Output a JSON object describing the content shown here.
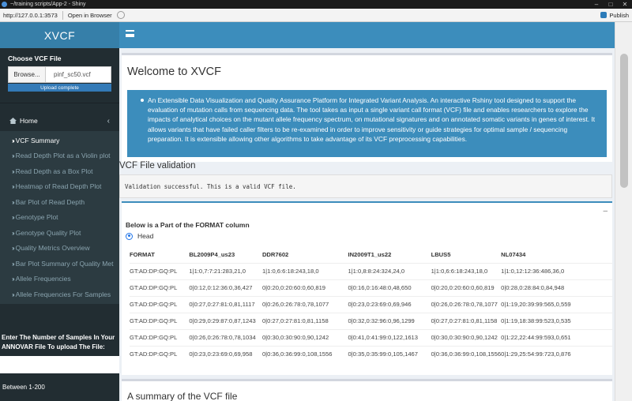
{
  "window": {
    "title": "~/training scripts/App-2 - Shiny"
  },
  "viewer": {
    "url": "http://127.0.0.1:3573",
    "open_browser": "Open in Browser",
    "publish": "Publish"
  },
  "sidebar": {
    "logo": "XVCF",
    "upload": {
      "label": "Choose VCF File",
      "browse": "Browse...",
      "filename": "pinf_sc50.vcf",
      "status": "Upload complete"
    },
    "home": "Home",
    "items": [
      {
        "label": "VCF Summary"
      },
      {
        "label": "Read Depth Plot as a Violin plot"
      },
      {
        "label": "Read Depth as a Box Plot"
      },
      {
        "label": "Heatmap of Read Depth Plot"
      },
      {
        "label": "Bar Plot of Read Depth"
      },
      {
        "label": "Genotype Plot"
      },
      {
        "label": "Genotype Quality Plot"
      },
      {
        "label": "Quality Metrics Overview"
      },
      {
        "label": "Bar Plot Summary of Quality Met"
      },
      {
        "label": "Allele Frequencies"
      },
      {
        "label": "Allele Frequencies For Samples"
      }
    ],
    "samples": {
      "question_1": "Enter The Number of Samples In Your",
      "question_2": "ANNOVAR File To upload The File:",
      "hint": "Between 1-200"
    }
  },
  "main": {
    "welcome_title": "Welcome to XVCF",
    "description": "An Extensible Data Visualization and Quality Assurance Platform for Integrated Variant Analysis. An interactive Rshiny tool designed to support the evaluation of mutation calls from sequencing data. The tool takes as input a single variant call format (VCF) file and enables researchers to explore the impacts of analytical choices on the mutant allele frequency spectrum, on mutational signatures and on annotated somatic variants in genes of interest. It allows variants that have failed caller filters to be re-examined in order to improve sensitivity or guide strategies for optimal sample / sequencing preparation. It is extensible allowing other algorithms to take advantage of its VCF preprocessing capabilities.",
    "validation_title": "VCF File validation",
    "validation_msg": "Validation successful. This is a valid VCF file.",
    "format_title": "Below is a Part of the FORMAT column",
    "radio_head": "Head",
    "table": {
      "headers": [
        "FORMAT",
        "BL2009P4_us23",
        "DDR7602",
        "IN2009T1_us22",
        "LBUS5",
        "NL07434"
      ],
      "rows": [
        [
          "GT:AD:DP:GQ:PL",
          "1|1:0,7:7:21:283,21,0",
          "1|1:0,6:6:18:243,18,0",
          "1|1:0,8:8:24:324,24,0",
          "1|1:0,6:6:18:243,18,0",
          "1|1:0,12:12:36:486,36,0"
        ],
        [
          "GT:AD:DP:GQ:PL",
          "0|0:12,0:12:36:0,36,427",
          "0|0:20,0:20:60:0,60,819",
          "0|0:16,0:16:48:0,48,650",
          "0|0:20,0:20:60:0,60,819",
          "0|0:28,0:28:84:0,84,948"
        ],
        [
          "GT:AD:DP:GQ:PL",
          "0|0:27,0:27:81:0,81,1117",
          "0|0:26,0:26:78:0,78,1077",
          "0|0:23,0:23:69:0,69,946",
          "0|0:26,0:26:78:0,78,1077",
          "0|1:19,20:39:99:565,0,559"
        ],
        [
          "GT:AD:DP:GQ:PL",
          "0|0:29,0:29:87:0,87,1243",
          "0|0:27,0:27:81:0,81,1158",
          "0|0:32,0:32:96:0,96,1299",
          "0|0:27,0:27:81:0,81,1158",
          "0|1:19,18:38:99:523,0,535"
        ],
        [
          "GT:AD:DP:GQ:PL",
          "0|0:26,0:26:78:0,78,1034",
          "0|0:30,0:30:90:0,90,1242",
          "0|0:41,0:41:99:0,122,1613",
          "0|0:30,0:30:90:0,90,1242",
          "0|1:22,22:44:99:593,0,651"
        ],
        [
          "GT:AD:DP:GQ:PL",
          "0|0:23,0:23:69:0,69,958",
          "0|0:36,0:36:99:0,108,1556",
          "0|0:35,0:35:99:0,105,1467",
          "0|0:36,0:36:99:0,108,1556",
          "0|1:29,25:54:99:723,0,876"
        ]
      ]
    },
    "summary_title": "A summary of the VCF file"
  },
  "colors": {
    "header": "#3c8dbc",
    "sidebar": "#222d32",
    "logo": "#367fa9"
  }
}
